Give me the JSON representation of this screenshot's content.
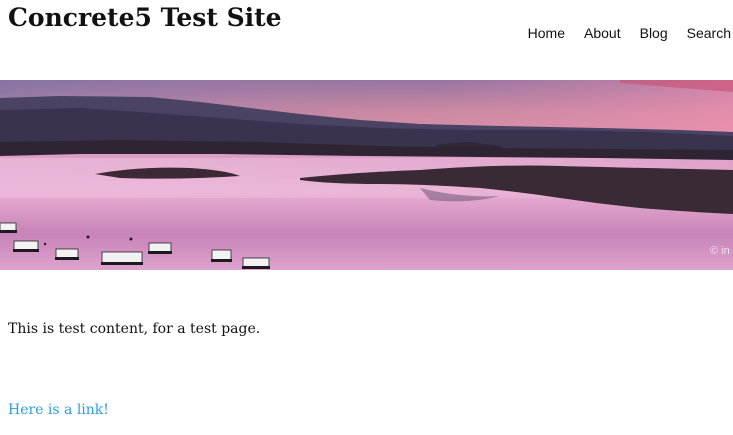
{
  "header": {
    "site_title": "Concrete5 Test Site",
    "nav": [
      "Home",
      "About",
      "Blog",
      "Search"
    ]
  },
  "banner": {
    "image": "lake-sunset-houseboats-panorama",
    "watermark_text": "© in",
    "colors": {
      "sky_top": "#8a6c9c",
      "sky_glow": "#e48fb1",
      "mountains": "#3c3550",
      "water_light": "#e9a8cf",
      "water_dark": "#b673a6",
      "shore": "#2e2431"
    }
  },
  "main": {
    "paragraph": "This is test content, for a test page.",
    "link_text": "Here is a link!"
  },
  "colors": {
    "link": "#2b9fd9",
    "text": "#111111"
  }
}
